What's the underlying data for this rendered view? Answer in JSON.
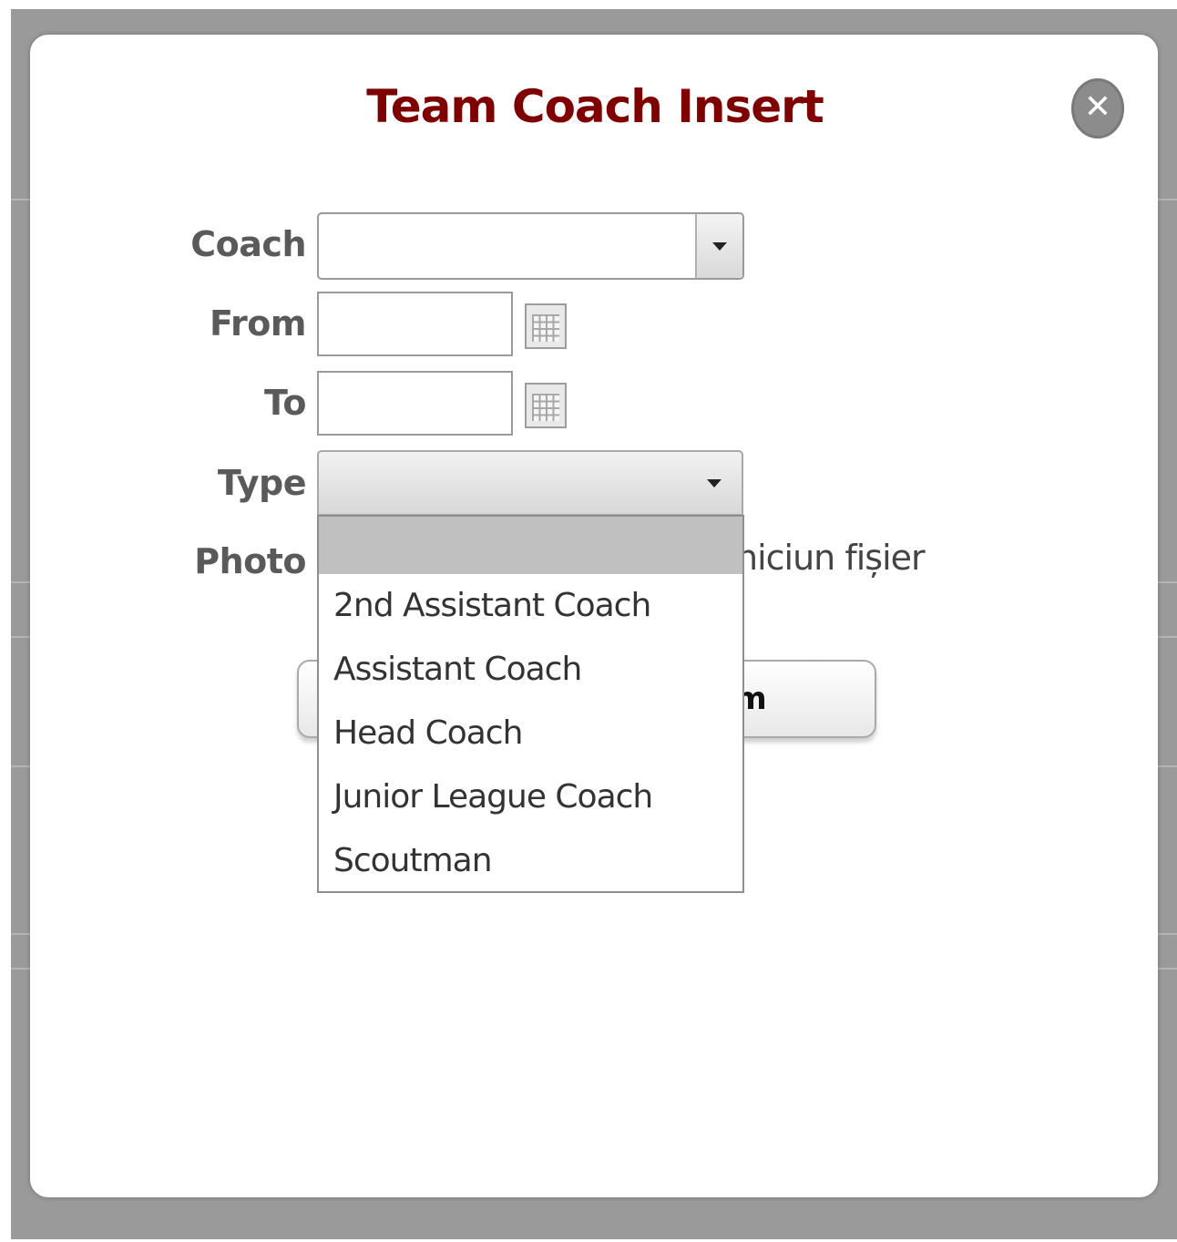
{
  "dialog": {
    "title": "Team Coach Insert",
    "close_label": "✕"
  },
  "form": {
    "coach_label": "Coach",
    "coach_value": "",
    "from_label": "From",
    "from_value": "",
    "to_label": "To",
    "to_value": "",
    "type_label": "Type",
    "type_value": "",
    "photo_label": "Photo",
    "photo_status_fragment": "niciun fișier"
  },
  "save_button_fragment": "m",
  "type_dropdown": {
    "options": [
      "",
      "2nd Assistant Coach",
      "Assistant Coach",
      "Head Coach",
      "Junior League Coach",
      "Scoutman"
    ],
    "selected_index": 0
  },
  "colors": {
    "title": "#7f0000",
    "label": "#5a5a5a",
    "backdrop": "#9a9a9a",
    "selected_option": "#c0c0c0"
  }
}
